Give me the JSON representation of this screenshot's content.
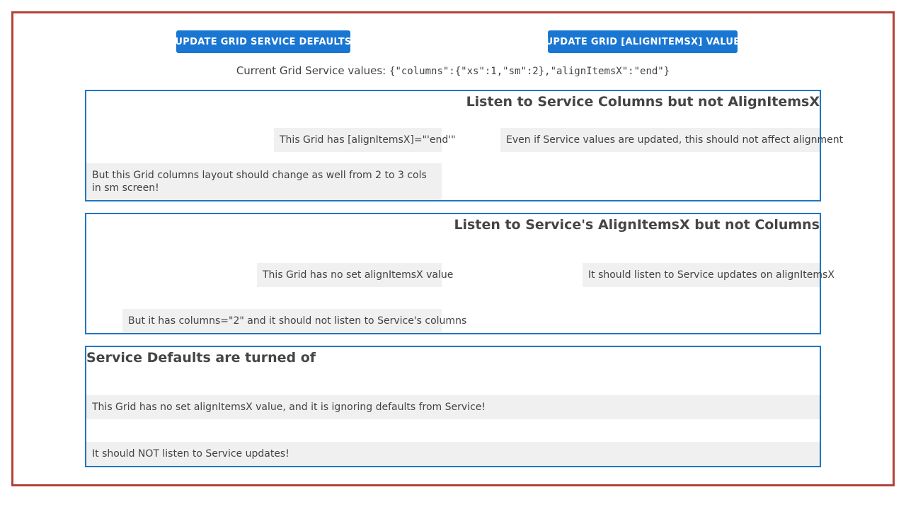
{
  "buttons": {
    "update_defaults": "UPDATE GRID SERVICE DEFAULTS",
    "update_align": "UPDATE GRID [ALIGNITEMSX] VALUE"
  },
  "status": {
    "label": "Current Grid Service values:",
    "value": "{\"columns\":{\"xs\":1,\"sm\":2},\"alignItemsX\":\"end\"}"
  },
  "panels": [
    {
      "title": "Listen to Service Columns but not AlignItemsX",
      "items": [
        "This Grid has [alignItemsX]=\"'end'\"",
        "Even if Service values are updated, this should not affect alignment",
        "But this Grid columns layout should change as well from 2 to 3 cols in sm screen!"
      ]
    },
    {
      "title": "Listen to Service's AlignItemsX but not Columns",
      "items": [
        "This Grid has no set alignItemsX value",
        "It should listen to Service updates on alignItemsX",
        "But it has columns=\"2\" and it should not listen to Service's columns"
      ]
    },
    {
      "title": "Service Defaults are turned of",
      "items": [
        "This Grid has no set alignItemsX value, and it is ignoring defaults from Service!",
        "It should NOT listen to Service updates!"
      ]
    }
  ],
  "colors": {
    "frame_border": "#b5403a",
    "panel_border": "#1e76c3",
    "button_bg": "#1976d2",
    "cell_bg": "#f0f0f0"
  }
}
